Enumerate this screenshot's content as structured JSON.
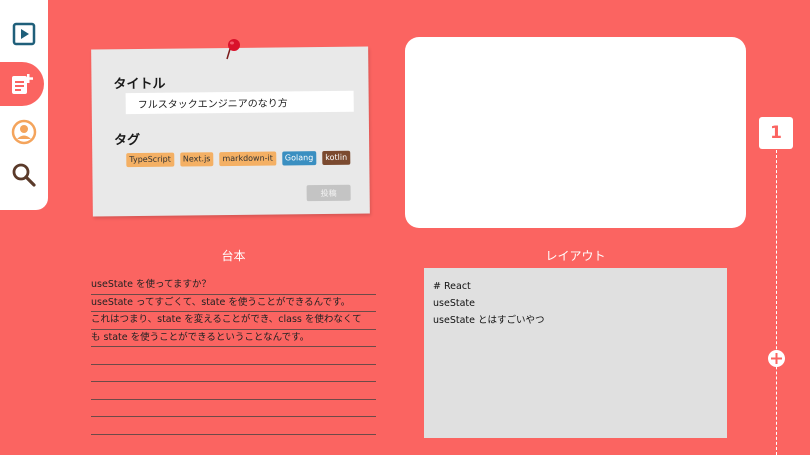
{
  "card": {
    "title_label": "タイトル",
    "title_value": "フルスタックエンジニアのなり方",
    "tag_label": "タグ",
    "tags": [
      {
        "label": "TypeScript",
        "bg": "#f4b064"
      },
      {
        "label": "Next.js",
        "bg": "#f4b064"
      },
      {
        "label": "markdown-it",
        "bg": "#f4b064"
      },
      {
        "label": "Golang",
        "bg": "#3a8fc1",
        "color": "#ffffff"
      },
      {
        "label": "kotlin",
        "bg": "#7b4a2f",
        "color": "#ffffff"
      }
    ],
    "post_button": "投稿"
  },
  "sections": {
    "script_heading": "台本",
    "layout_heading": "レイアウト"
  },
  "script_lines": [
    "useState を使ってますか？",
    "useState ってすごくて、state を使うことができるんです。",
    "これはつまり、state を変えることができ、class を使わなくて",
    "も state を使うことができるということなんです。",
    "",
    "",
    "",
    "",
    ""
  ],
  "layout_lines": [
    "# React",
    "useState",
    "useState とはすごいやつ"
  ],
  "timeline": {
    "current_page": "1"
  },
  "colors": {
    "background": "#fb6461",
    "accent": "#fb6461",
    "orange_icon": "#f4a45c",
    "sidebar_icon": "#1f5f7a"
  }
}
